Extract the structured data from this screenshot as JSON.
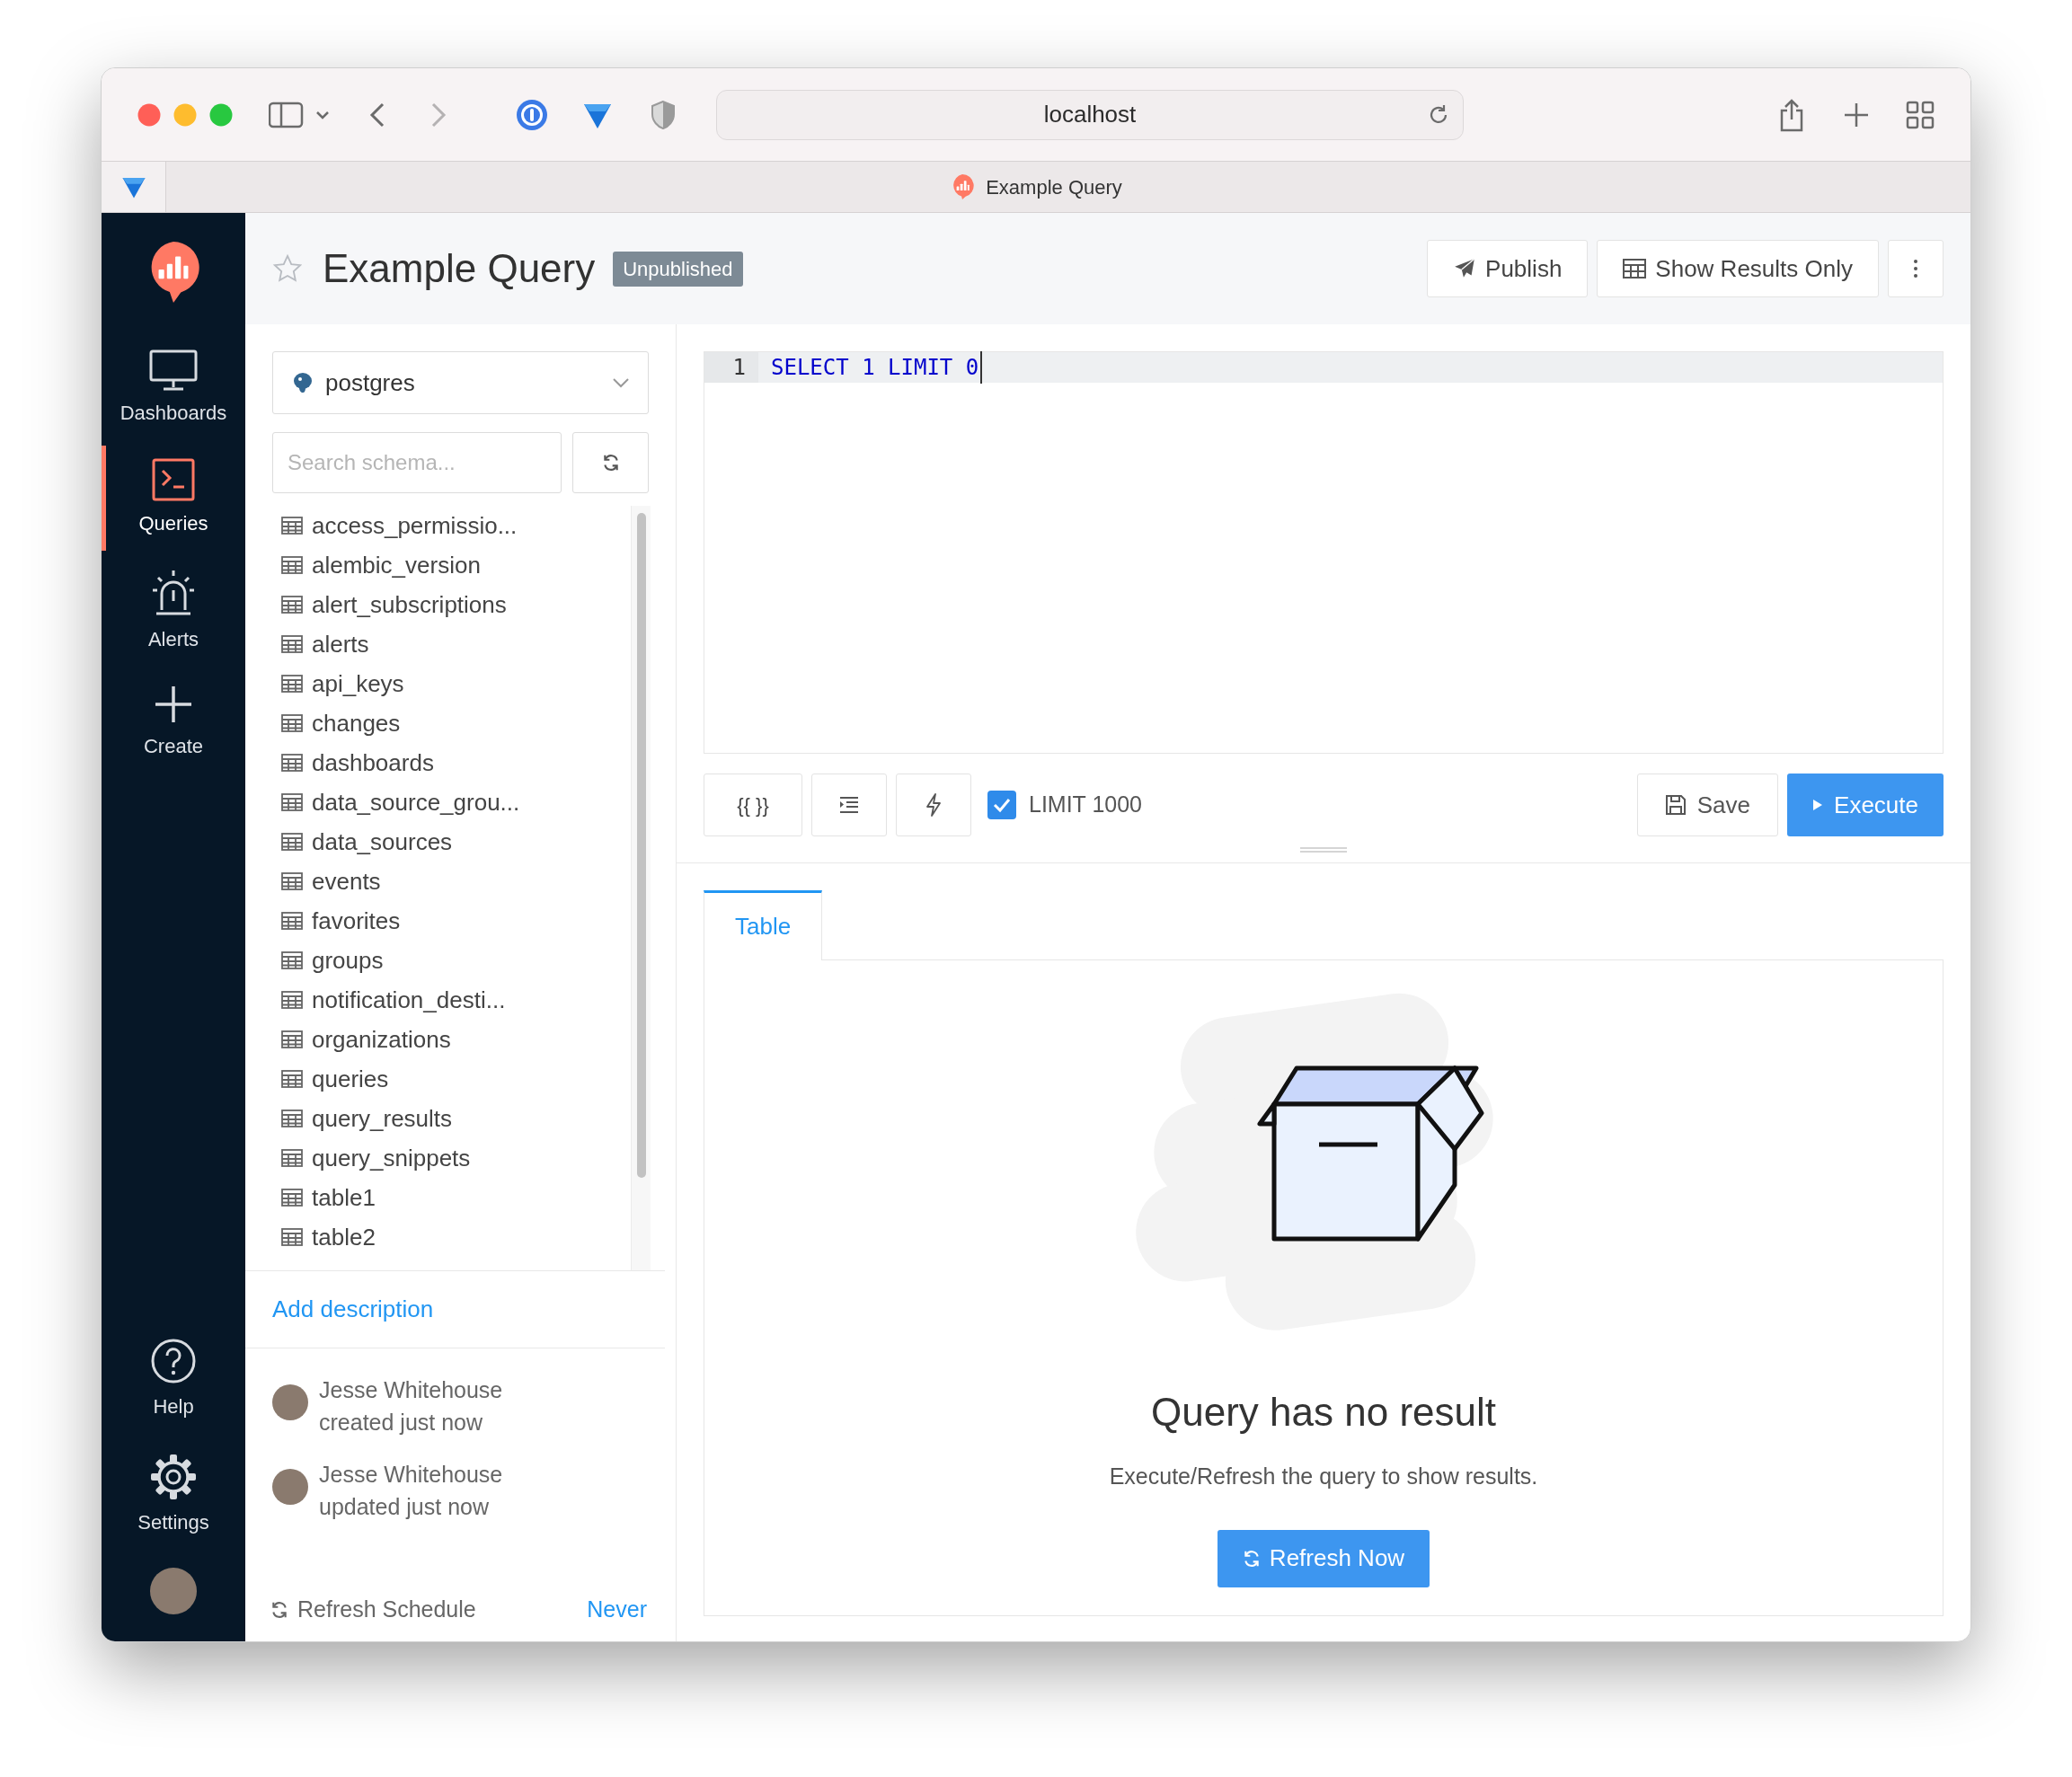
{
  "browser": {
    "url": "localhost",
    "tab_title": "Example Query"
  },
  "sidebar": {
    "items": [
      {
        "label": "Dashboards",
        "kind": "dashboards",
        "selected": false
      },
      {
        "label": "Queries",
        "kind": "queries",
        "selected": true
      },
      {
        "label": "Alerts",
        "kind": "alerts",
        "selected": false
      },
      {
        "label": "Create",
        "kind": "create",
        "selected": false
      }
    ],
    "bottom_items": [
      {
        "label": "Help",
        "kind": "help"
      },
      {
        "label": "Settings",
        "kind": "settings"
      }
    ]
  },
  "header": {
    "title": "Example Query",
    "favorite": false,
    "badge": "Unpublished",
    "buttons": [
      {
        "label": "Publish",
        "kind": "publish"
      },
      {
        "label": "Show Results Only",
        "kind": "table"
      }
    ]
  },
  "schema": {
    "data_source": "postgres",
    "search": {
      "placeholder": "Search schema..."
    },
    "tables": [
      "access_permissio...",
      "alembic_version",
      "alert_subscriptions",
      "alerts",
      "api_keys",
      "changes",
      "dashboards",
      "data_source_grou...",
      "data_sources",
      "events",
      "favorites",
      "groups",
      "notification_desti...",
      "organizations",
      "queries",
      "query_results",
      "query_snippets",
      "table1",
      "table2"
    ]
  },
  "description_link": "Add description",
  "activity": [
    {
      "user": "Jesse Whitehouse",
      "action": "created just now"
    },
    {
      "user": "Jesse Whitehouse",
      "action": "updated just now"
    }
  ],
  "refresh_schedule": {
    "label": "Refresh Schedule",
    "value": "Never"
  },
  "editor": {
    "lines": [
      {
        "number": "1",
        "code": "SELECT 1 LIMIT 0"
      }
    ]
  },
  "toolbar": {
    "buttons": [
      {
        "kind": "params",
        "label": "{{ }}"
      },
      {
        "kind": "format"
      },
      {
        "kind": "autocomplete"
      }
    ],
    "limit": {
      "label": "LIMIT 1000",
      "checked": true
    },
    "save": "Save",
    "execute": "Execute"
  },
  "results": {
    "tabs": [
      {
        "label": "Table",
        "selected": true
      }
    ],
    "empty": {
      "title": "Query has no result",
      "message": "Execute/Refresh the query to show results.",
      "button": "Refresh Now"
    }
  }
}
